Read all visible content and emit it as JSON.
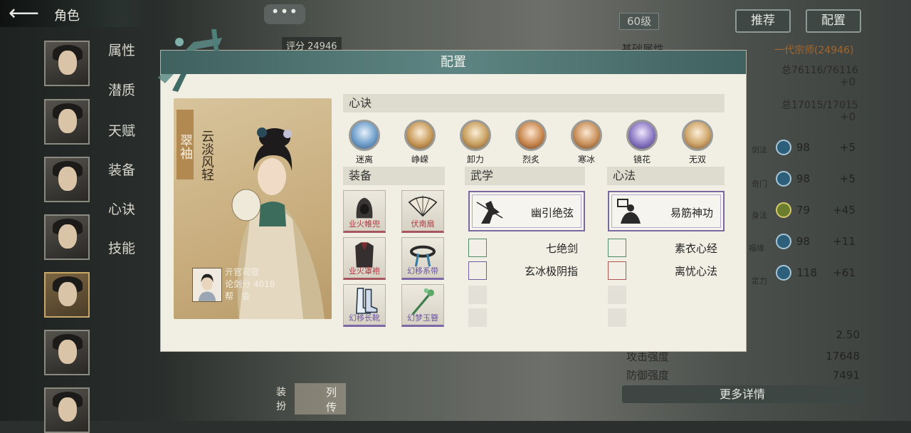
{
  "background": {
    "back_icon": "back-arrow-icon",
    "title": "角色",
    "nav": [
      "属性",
      "潜质",
      "天赋",
      "装备",
      "心诀",
      "技能"
    ],
    "level": "60级",
    "buttons": [
      "推荐",
      "配置"
    ],
    "score": "评分 24946",
    "chat": "•••",
    "stats_header": "基础属性",
    "rank": "一代宗师(24946)",
    "total1": "总76116/76116",
    "plus1": "+0",
    "total2": "总17015/17015",
    "plus2": "+0",
    "stats": [
      {
        "label": "剑法",
        "value": "98",
        "bonus": "+5"
      },
      {
        "label": "奇门",
        "value": "98",
        "bonus": "+5"
      },
      {
        "label": "身法",
        "value": "79",
        "bonus": "+45"
      },
      {
        "label": "福缘",
        "value": "98",
        "bonus": "+11"
      },
      {
        "label": "定力",
        "value": "118",
        "bonus": "+61"
      }
    ],
    "crit_value": "2.50",
    "attack_label": "攻击强度",
    "attack_value": "17648",
    "defense_label": "防御强度",
    "defense_value": "7491",
    "more_details": "更多详情",
    "bottom_btn1": "装扮",
    "bottom_btn2": "列传"
  },
  "modal": {
    "title": "配置",
    "card": {
      "name": "翠袖",
      "motto": "云淡风轻",
      "title_line": "亓官司寇",
      "score_label": "论剑分",
      "score": "4018",
      "guild_label": "帮",
      "guild_value": "会"
    },
    "xinjue_header": "心诀",
    "xinjue": [
      {
        "name": "迷离",
        "color": "#6f9fcb"
      },
      {
        "name": "峥嵘",
        "color": "#c89a5a"
      },
      {
        "name": "卸力",
        "color": "#c9a060"
      },
      {
        "name": "烈炙",
        "color": "#c98850"
      },
      {
        "name": "寒冰",
        "color": "#c9905a"
      },
      {
        "name": "镜花",
        "color": "#8b78c4"
      },
      {
        "name": "无双",
        "color": "#cfa56a"
      }
    ],
    "equip_header": "装备",
    "equipment": [
      {
        "name": "业火帷兜",
        "rarity": "red"
      },
      {
        "name": "伏南扇",
        "rarity": "red"
      },
      {
        "name": "业火罩袍",
        "rarity": "red"
      },
      {
        "name": "幻移系带",
        "rarity": "purple"
      },
      {
        "name": "幻移长靴",
        "rarity": "purple"
      },
      {
        "name": "幻梦玉簪",
        "rarity": "purple"
      }
    ],
    "wuxue_header": "武学",
    "wuxue_main": "幽引绝弦",
    "wuxue_sub": [
      {
        "name": "七绝剑",
        "rarity": "green"
      },
      {
        "name": "玄冰极阴指",
        "rarity": "purple"
      }
    ],
    "xinfa_header": "心法",
    "xinfa_main": "易筋神功",
    "xinfa_sub": [
      {
        "name": "素衣心经",
        "rarity": "green"
      },
      {
        "name": "离忧心法",
        "rarity": "red"
      }
    ]
  }
}
